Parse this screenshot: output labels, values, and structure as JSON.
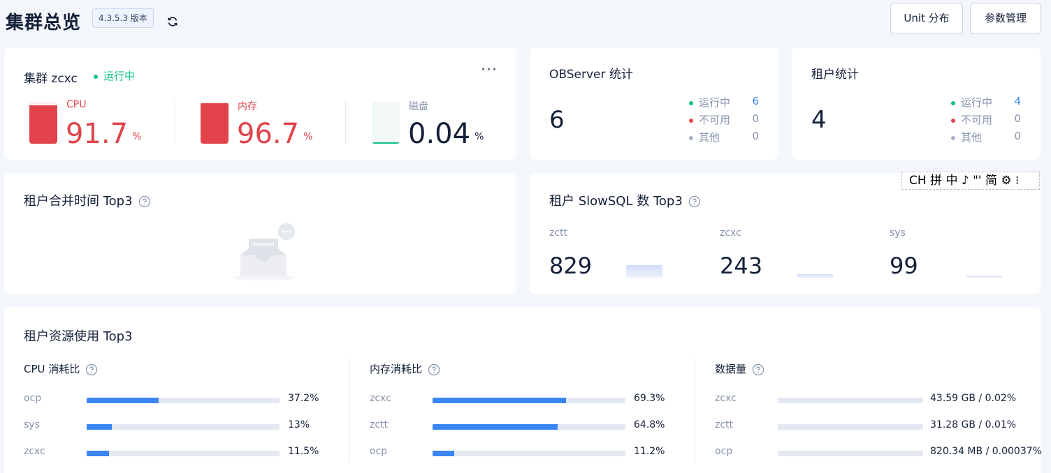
{
  "header": {
    "title": "集群总览",
    "version": "4.3.5.3 版本",
    "unit_button": "Unit 分布",
    "param_button": "参数管理"
  },
  "cluster": {
    "title": "集群 zcxc",
    "status": "运行中",
    "metrics": [
      {
        "label": "CPU",
        "value": "91.7",
        "unit": "%",
        "percent": 91.7,
        "color": "#e2434a"
      },
      {
        "label": "内存",
        "value": "96.7",
        "unit": "%",
        "percent": 96.7,
        "color": "#e2434a"
      },
      {
        "label": "磁盘",
        "value": "0.04",
        "unit": "%",
        "percent": 0.04,
        "color": "#0ac185"
      }
    ]
  },
  "observer_stats": {
    "title": "OBServer 统计",
    "total": "6",
    "items": [
      {
        "label": "运行中",
        "value": "6",
        "dot_color": "#0ac185",
        "value_color": "#3b86f2"
      },
      {
        "label": "不可用",
        "value": "0",
        "dot_color": "#e2434a",
        "value_color": "#8592ad"
      },
      {
        "label": "其他",
        "value": "0",
        "dot_color": "#a7b2c6",
        "value_color": "#8592ad"
      }
    ]
  },
  "tenant_stats": {
    "title": "租户统计",
    "total": "4",
    "items": [
      {
        "label": "运行中",
        "value": "4",
        "dot_color": "#0ac185",
        "value_color": "#3b86f2"
      },
      {
        "label": "不可用",
        "value": "0",
        "dot_color": "#e2434a",
        "value_color": "#8592ad"
      },
      {
        "label": "其他",
        "value": "0",
        "dot_color": "#a7b2c6",
        "value_color": "#8592ad"
      }
    ]
  },
  "merge_time": {
    "title": "租户合并时间 Top3"
  },
  "ime": {
    "text": "CH 拼 中 ♪ \"' 简 ⚙ ⁝"
  },
  "slowsql": {
    "title": "租户 SlowSQL 数 Top3",
    "items": [
      {
        "name": "zctt",
        "value": "829",
        "ratio": 1.0
      },
      {
        "name": "zcxc",
        "value": "243",
        "ratio": 0.29
      },
      {
        "name": "sys",
        "value": "99",
        "ratio": 0.12
      }
    ]
  },
  "resource": {
    "title": "租户资源使用 Top3",
    "sections": [
      {
        "title": "CPU 消耗比",
        "rows": [
          {
            "name": "ocp",
            "value": "37.2%",
            "percent": 37.2
          },
          {
            "name": "sys",
            "value": "13%",
            "percent": 13
          },
          {
            "name": "zcxc",
            "value": "11.5%",
            "percent": 11.5
          }
        ]
      },
      {
        "title": "内存消耗比",
        "rows": [
          {
            "name": "zcxc",
            "value": "69.3%",
            "percent": 69.3
          },
          {
            "name": "zctt",
            "value": "64.8%",
            "percent": 64.8
          },
          {
            "name": "ocp",
            "value": "11.2%",
            "percent": 11.2
          }
        ]
      },
      {
        "title": "数据量",
        "rows": [
          {
            "name": "zcxc",
            "value": "43.59 GB / 0.02%",
            "percent": 0.02
          },
          {
            "name": "zctt",
            "value": "31.28 GB / 0.01%",
            "percent": 0.01
          },
          {
            "name": "ocp",
            "value": "820.34 MB / 0.00037%",
            "percent": 0.00037
          }
        ]
      }
    ]
  },
  "colors": {
    "accent": "#3b86f2",
    "danger": "#e2434a",
    "success": "#0ac185",
    "muted": "#8592ad"
  }
}
